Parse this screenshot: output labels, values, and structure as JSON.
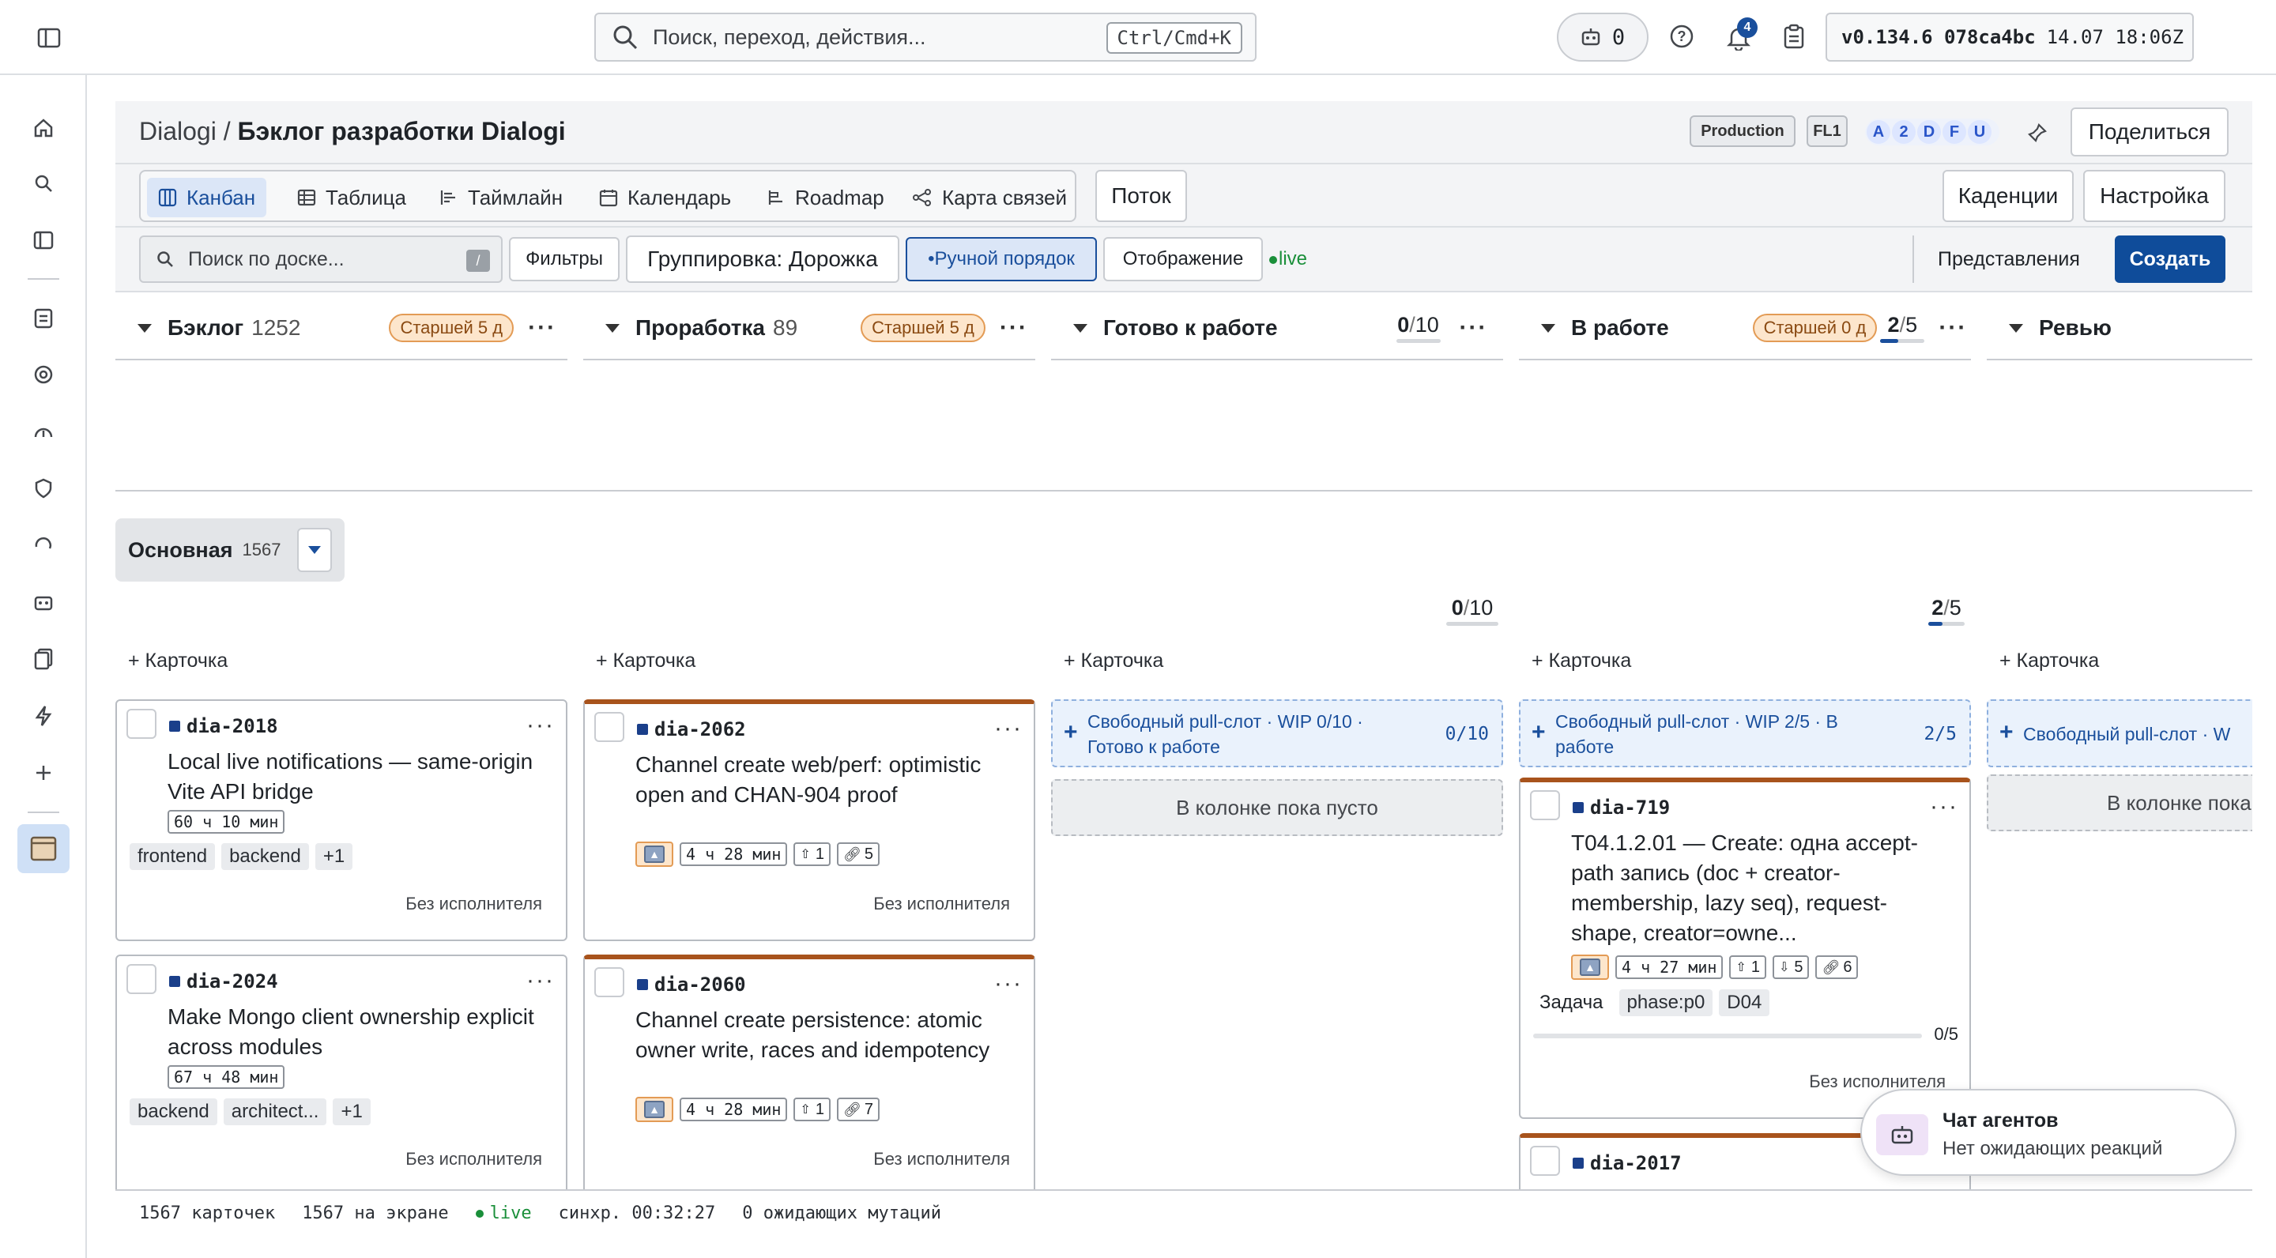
{
  "topbar": {
    "search_placeholder": "Поиск, переход, действия...",
    "search_shortcut": "Ctrl/Cmd+K",
    "agent_count": "0",
    "notifications_badge": "4",
    "version": "v0.134.6 078ca4bc",
    "version_time": "14.07 18:06Z"
  },
  "header": {
    "workspace": "Dialogi",
    "separator": "/",
    "board_title": "Бэклог разработки Dialogi",
    "env_badge": "Production",
    "fl_badge": "FL1",
    "avatars": [
      "A",
      "2",
      "D",
      "F",
      "U"
    ],
    "share_label": "Поделиться"
  },
  "views": {
    "tabs": [
      {
        "label": "Канбан",
        "icon": "kanban-icon",
        "active": true
      },
      {
        "label": "Таблица",
        "icon": "table-icon"
      },
      {
        "label": "Таймлайн",
        "icon": "timeline-icon"
      },
      {
        "label": "Календарь",
        "icon": "calendar-icon"
      },
      {
        "label": "Roadmap",
        "icon": "roadmap-icon"
      },
      {
        "label": "Карта связей",
        "icon": "graph-icon"
      }
    ],
    "flow_label": "Поток",
    "cadences_label": "Каденции",
    "settings_label": "Настройка"
  },
  "toolbar": {
    "board_search_placeholder": "Поиск по доске...",
    "board_search_shortcut": "/",
    "filters_label": "Фильтры",
    "grouping_label": "Группировка: Дорожка",
    "manual_order_label": "•Ручной порядок",
    "display_label": "Отображение",
    "live_label": "live",
    "views_label": "Представления",
    "create_label": "Создать"
  },
  "columns": [
    {
      "title": "Бэклог",
      "count": "1252",
      "older": "Старшей 5 д"
    },
    {
      "title": "Проработка",
      "count": "89",
      "older": "Старшей 5 д"
    },
    {
      "title": "Готово к работе",
      "wip": "0",
      "wip_sep": "/",
      "wip_limit": "10",
      "wip_fraction": 0
    },
    {
      "title": "В работе",
      "older": "Старшей 0 д",
      "wip": "2",
      "wip_sep": "/",
      "wip_limit": "5",
      "wip_fraction": 0.4
    },
    {
      "title": "Ревью"
    }
  ],
  "lane": {
    "name": "Основная",
    "count": "1567",
    "wip_ready": "0",
    "wip_ready_limit": "10",
    "wip_work": "2",
    "wip_work_limit": "5",
    "wip_sep": "/"
  },
  "add_card_label": "+ Карточка",
  "no_assignee": "Без исполнителя",
  "empty_column": "В колонке пока пусто",
  "empty_column_cut": "В колонке пока",
  "slots": {
    "ready_text": "Свободный pull-слот · WIP 0/10 · Готово к работе",
    "ready_count": "0/10",
    "work_text": "Свободный pull-слот · WIP 2/5 · В работе",
    "work_count": "2/5",
    "review_text": "Свободный pull-слот · W"
  },
  "cards": {
    "c2018": {
      "id": "dia-2018",
      "title": "Local live notifications — same-origin Vite API bridge",
      "time": "60 ч 10 мин",
      "tags": [
        "frontend",
        "backend",
        "+1"
      ]
    },
    "c2024": {
      "id": "dia-2024",
      "title": "Make Mongo client ownership explicit across modules",
      "time": "67 ч 48 мин",
      "tags": [
        "backend",
        "architect...",
        "+1"
      ]
    },
    "c2062": {
      "id": "dia-2062",
      "title": "Channel create web/perf: optimistic open and CHAN-904 proof",
      "time": "4 ч 28 мин",
      "up": "1",
      "links": "5"
    },
    "c2060": {
      "id": "dia-2060",
      "title": "Channel create persistence: atomic owner write, races and idempotency",
      "time": "4 ч 28 мин",
      "up": "1",
      "links": "7"
    },
    "c719": {
      "id": "dia-719",
      "title": "T04.1.2.01 — Create: одна accept-path запись (doc + creator-membership, lazy seq), request-shape, creator=owne...",
      "time": "4 ч 27 мин",
      "up": "1",
      "down": "5",
      "links": "6",
      "type": "Задача",
      "tags": [
        "phase:p0",
        "D04"
      ],
      "progress": "0/5"
    },
    "c2017": {
      "id": "dia-2017"
    }
  },
  "statusbar": {
    "cards": "1567 карточек",
    "on_screen": "1567 на экране",
    "live": "live",
    "sync": "синхр. 00:32:27",
    "pending": "0 ожидающих мутаций"
  },
  "toast": {
    "title": "Чат агентов",
    "subtitle": "Нет ожидающих реакций"
  },
  "colors": {
    "accent": "#1a4f9c",
    "primary_button": "#0f4c9a",
    "older_badge": "#fde6cc",
    "live": "#1a8f3a",
    "hot_card": "#a8531c"
  }
}
